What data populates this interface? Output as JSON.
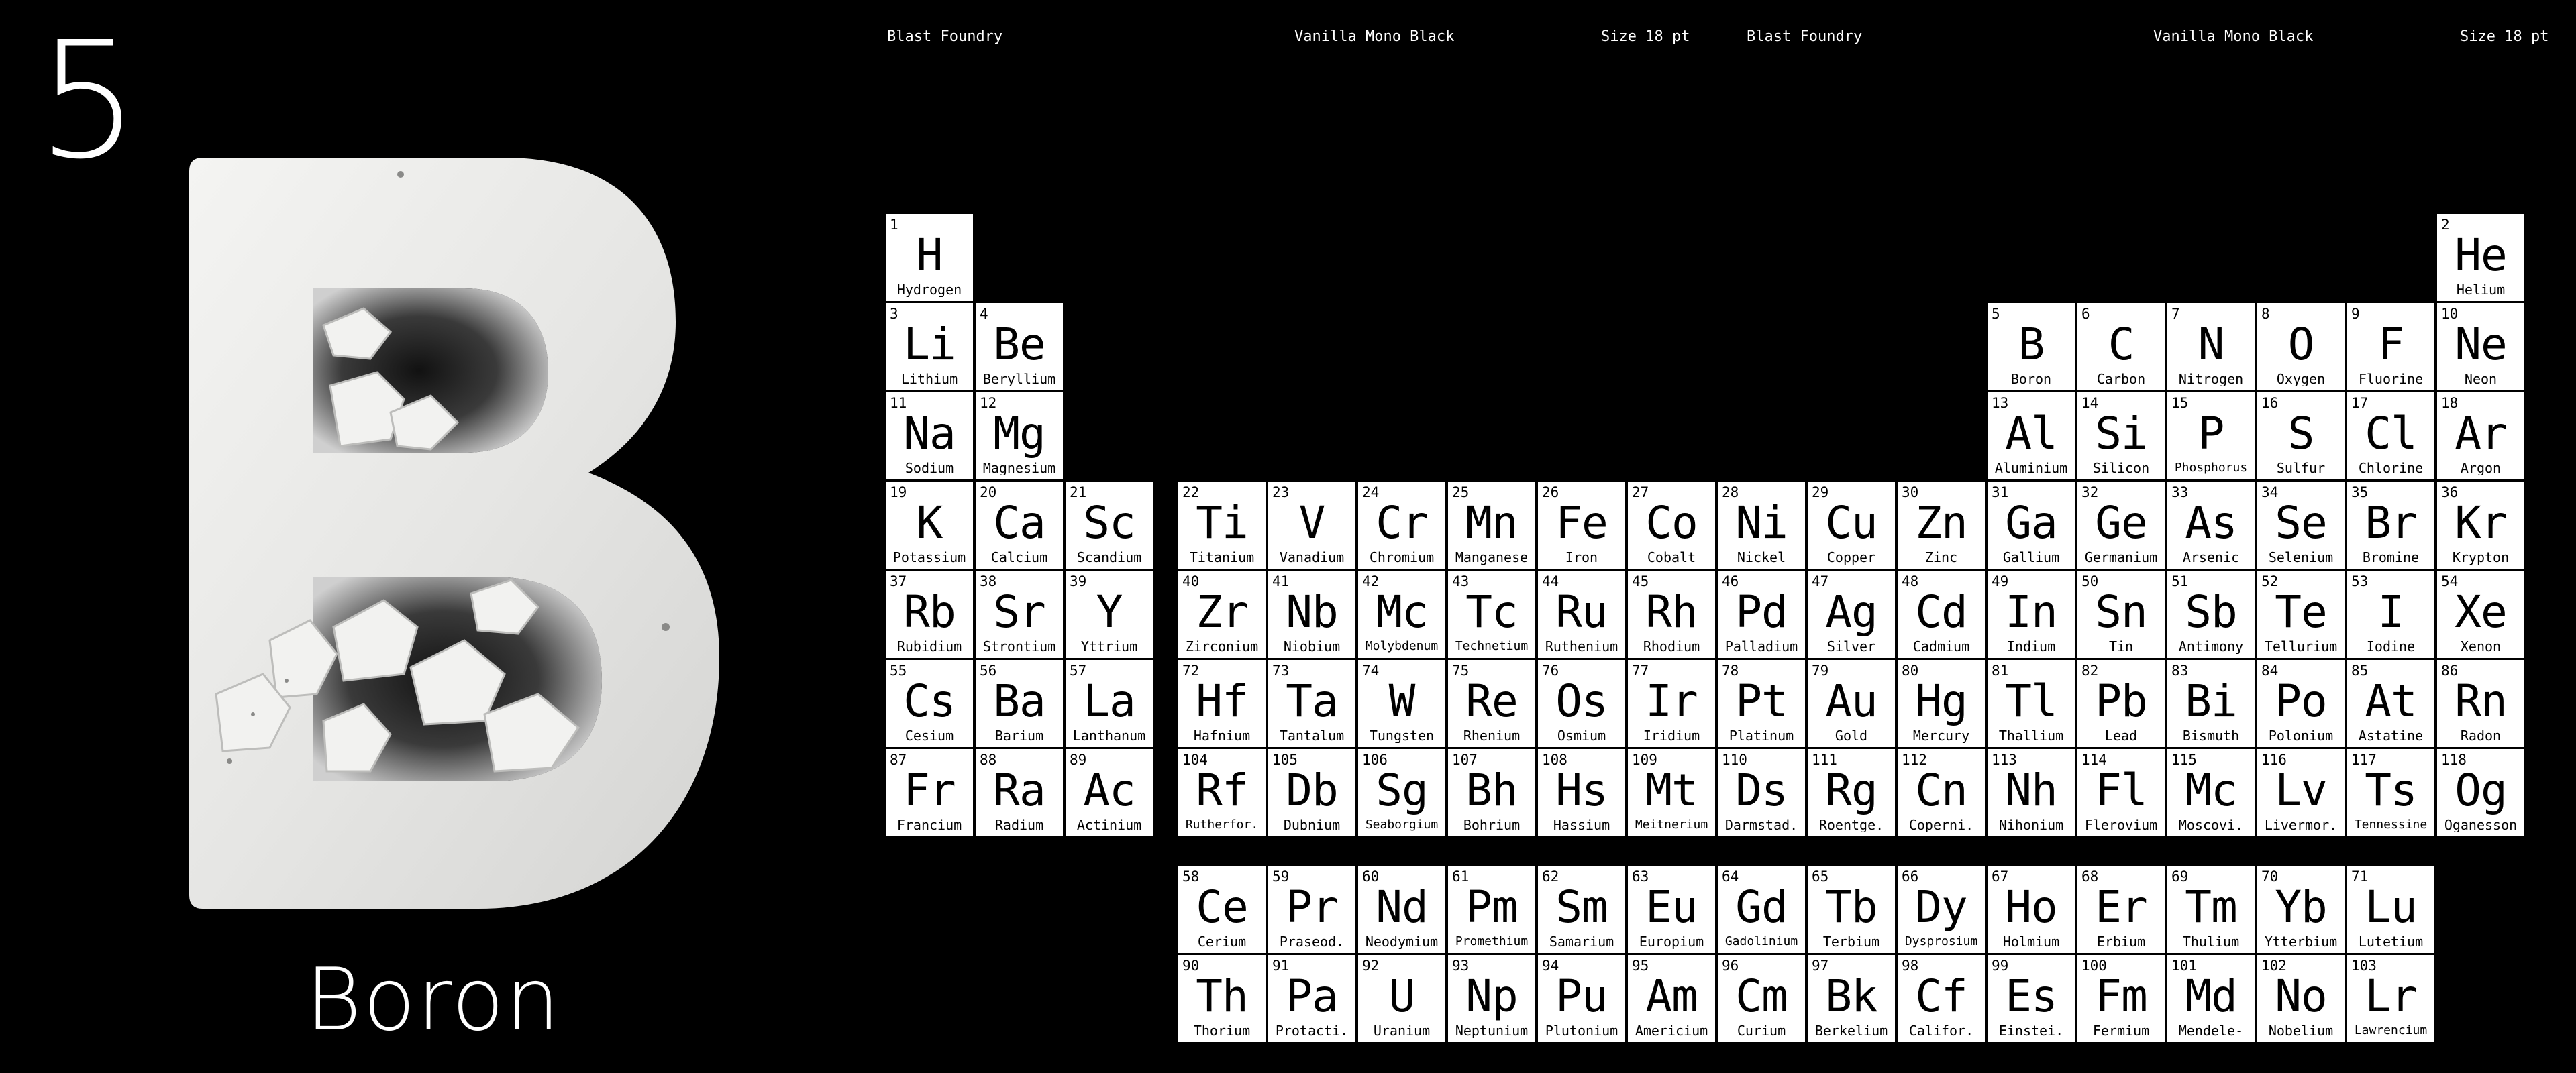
{
  "poster": {
    "atomic_number": "5",
    "letter": "B",
    "name": "Boron"
  },
  "header": {
    "left": {
      "foundry": "Blast Foundry",
      "font": "Vanilla Mono Black",
      "size": "Size 18 pt"
    },
    "right": {
      "foundry": "Blast Foundry",
      "font": "Vanilla Mono Black",
      "size": "Size 18 pt"
    }
  },
  "elements": [
    {
      "n": "1",
      "s": "H",
      "name": "Hydrogen",
      "r": 1,
      "c": 1
    },
    {
      "n": "2",
      "s": "He",
      "name": "Helium",
      "r": 1,
      "c": 18
    },
    {
      "n": "3",
      "s": "Li",
      "name": "Lithium",
      "r": 2,
      "c": 1
    },
    {
      "n": "4",
      "s": "Be",
      "name": "Beryllium",
      "r": 2,
      "c": 2
    },
    {
      "n": "5",
      "s": "B",
      "name": "Boron",
      "r": 2,
      "c": 13
    },
    {
      "n": "6",
      "s": "C",
      "name": "Carbon",
      "r": 2,
      "c": 14
    },
    {
      "n": "7",
      "s": "N",
      "name": "Nitrogen",
      "r": 2,
      "c": 15
    },
    {
      "n": "8",
      "s": "O",
      "name": "Oxygen",
      "r": 2,
      "c": 16
    },
    {
      "n": "9",
      "s": "F",
      "name": "Fluorine",
      "r": 2,
      "c": 17
    },
    {
      "n": "10",
      "s": "Ne",
      "name": "Neon",
      "r": 2,
      "c": 18
    },
    {
      "n": "11",
      "s": "Na",
      "name": "Sodium",
      "r": 3,
      "c": 1
    },
    {
      "n": "12",
      "s": "Mg",
      "name": "Magnesium",
      "r": 3,
      "c": 2
    },
    {
      "n": "13",
      "s": "Al",
      "name": "Aluminium",
      "r": 3,
      "c": 13
    },
    {
      "n": "14",
      "s": "Si",
      "name": "Silicon",
      "r": 3,
      "c": 14
    },
    {
      "n": "15",
      "s": "P",
      "name": "Phosphorus",
      "r": 3,
      "c": 15
    },
    {
      "n": "16",
      "s": "S",
      "name": "Sulfur",
      "r": 3,
      "c": 16
    },
    {
      "n": "17",
      "s": "Cl",
      "name": "Chlorine",
      "r": 3,
      "c": 17
    },
    {
      "n": "18",
      "s": "Ar",
      "name": "Argon",
      "r": 3,
      "c": 18
    },
    {
      "n": "19",
      "s": "K",
      "name": "Potassium",
      "r": 4,
      "c": 1
    },
    {
      "n": "20",
      "s": "Ca",
      "name": "Calcium",
      "r": 4,
      "c": 2
    },
    {
      "n": "21",
      "s": "Sc",
      "name": "Scandium",
      "r": 4,
      "c": 3
    },
    {
      "n": "22",
      "s": "Ti",
      "name": "Titanium",
      "r": 4,
      "c": 4
    },
    {
      "n": "23",
      "s": "V",
      "name": "Vanadium",
      "r": 4,
      "c": 5
    },
    {
      "n": "24",
      "s": "Cr",
      "name": "Chromium",
      "r": 4,
      "c": 6
    },
    {
      "n": "25",
      "s": "Mn",
      "name": "Manganese",
      "r": 4,
      "c": 7
    },
    {
      "n": "26",
      "s": "Fe",
      "name": "Iron",
      "r": 4,
      "c": 8
    },
    {
      "n": "27",
      "s": "Co",
      "name": "Cobalt",
      "r": 4,
      "c": 9
    },
    {
      "n": "28",
      "s": "Ni",
      "name": "Nickel",
      "r": 4,
      "c": 10
    },
    {
      "n": "29",
      "s": "Cu",
      "name": "Copper",
      "r": 4,
      "c": 11
    },
    {
      "n": "30",
      "s": "Zn",
      "name": "Zinc",
      "r": 4,
      "c": 12
    },
    {
      "n": "31",
      "s": "Ga",
      "name": "Gallium",
      "r": 4,
      "c": 13
    },
    {
      "n": "32",
      "s": "Ge",
      "name": "Germanium",
      "r": 4,
      "c": 14
    },
    {
      "n": "33",
      "s": "As",
      "name": "Arsenic",
      "r": 4,
      "c": 15
    },
    {
      "n": "34",
      "s": "Se",
      "name": "Selenium",
      "r": 4,
      "c": 16
    },
    {
      "n": "35",
      "s": "Br",
      "name": "Bromine",
      "r": 4,
      "c": 17
    },
    {
      "n": "36",
      "s": "Kr",
      "name": "Krypton",
      "r": 4,
      "c": 18
    },
    {
      "n": "37",
      "s": "Rb",
      "name": "Rubidium",
      "r": 5,
      "c": 1
    },
    {
      "n": "38",
      "s": "Sr",
      "name": "Strontium",
      "r": 5,
      "c": 2
    },
    {
      "n": "39",
      "s": "Y",
      "name": "Yttrium",
      "r": 5,
      "c": 3
    },
    {
      "n": "40",
      "s": "Zr",
      "name": "Zirconium",
      "r": 5,
      "c": 4
    },
    {
      "n": "41",
      "s": "Nb",
      "name": "Niobium",
      "r": 5,
      "c": 5
    },
    {
      "n": "42",
      "s": "Mc",
      "name": "Molybdenum",
      "r": 5,
      "c": 6
    },
    {
      "n": "43",
      "s": "Tc",
      "name": "Technetium",
      "r": 5,
      "c": 7
    },
    {
      "n": "44",
      "s": "Ru",
      "name": "Ruthenium",
      "r": 5,
      "c": 8
    },
    {
      "n": "45",
      "s": "Rh",
      "name": "Rhodium",
      "r": 5,
      "c": 9
    },
    {
      "n": "46",
      "s": "Pd",
      "name": "Palladium",
      "r": 5,
      "c": 10
    },
    {
      "n": "47",
      "s": "Ag",
      "name": "Silver",
      "r": 5,
      "c": 11
    },
    {
      "n": "48",
      "s": "Cd",
      "name": "Cadmium",
      "r": 5,
      "c": 12
    },
    {
      "n": "49",
      "s": "In",
      "name": "Indium",
      "r": 5,
      "c": 13
    },
    {
      "n": "50",
      "s": "Sn",
      "name": "Tin",
      "r": 5,
      "c": 14
    },
    {
      "n": "51",
      "s": "Sb",
      "name": "Antimony",
      "r": 5,
      "c": 15
    },
    {
      "n": "52",
      "s": "Te",
      "name": "Tellurium",
      "r": 5,
      "c": 16
    },
    {
      "n": "53",
      "s": "I",
      "name": "Iodine",
      "r": 5,
      "c": 17
    },
    {
      "n": "54",
      "s": "Xe",
      "name": "Xenon",
      "r": 5,
      "c": 18
    },
    {
      "n": "55",
      "s": "Cs",
      "name": "Cesium",
      "r": 6,
      "c": 1
    },
    {
      "n": "56",
      "s": "Ba",
      "name": "Barium",
      "r": 6,
      "c": 2
    },
    {
      "n": "57",
      "s": "La",
      "name": "Lanthanum",
      "r": 6,
      "c": 3
    },
    {
      "n": "72",
      "s": "Hf",
      "name": "Hafnium",
      "r": 6,
      "c": 4
    },
    {
      "n": "73",
      "s": "Ta",
      "name": "Tantalum",
      "r": 6,
      "c": 5
    },
    {
      "n": "74",
      "s": "W",
      "name": "Tungsten",
      "r": 6,
      "c": 6
    },
    {
      "n": "75",
      "s": "Re",
      "name": "Rhenium",
      "r": 6,
      "c": 7
    },
    {
      "n": "76",
      "s": "Os",
      "name": "Osmium",
      "r": 6,
      "c": 8
    },
    {
      "n": "77",
      "s": "Ir",
      "name": "Iridium",
      "r": 6,
      "c": 9
    },
    {
      "n": "78",
      "s": "Pt",
      "name": "Platinum",
      "r": 6,
      "c": 10
    },
    {
      "n": "79",
      "s": "Au",
      "name": "Gold",
      "r": 6,
      "c": 11
    },
    {
      "n": "80",
      "s": "Hg",
      "name": "Mercury",
      "r": 6,
      "c": 12
    },
    {
      "n": "81",
      "s": "Tl",
      "name": "Thallium",
      "r": 6,
      "c": 13
    },
    {
      "n": "82",
      "s": "Pb",
      "name": "Lead",
      "r": 6,
      "c": 14
    },
    {
      "n": "83",
      "s": "Bi",
      "name": "Bismuth",
      "r": 6,
      "c": 15
    },
    {
      "n": "84",
      "s": "Po",
      "name": "Polonium",
      "r": 6,
      "c": 16
    },
    {
      "n": "85",
      "s": "At",
      "name": "Astatine",
      "r": 6,
      "c": 17
    },
    {
      "n": "86",
      "s": "Rn",
      "name": "Radon",
      "r": 6,
      "c": 18
    },
    {
      "n": "87",
      "s": "Fr",
      "name": "Francium",
      "r": 7,
      "c": 1
    },
    {
      "n": "88",
      "s": "Ra",
      "name": "Radium",
      "r": 7,
      "c": 2
    },
    {
      "n": "89",
      "s": "Ac",
      "name": "Actinium",
      "r": 7,
      "c": 3
    },
    {
      "n": "104",
      "s": "Rf",
      "name": "Rutherfor.",
      "r": 7,
      "c": 4
    },
    {
      "n": "105",
      "s": "Db",
      "name": "Dubnium",
      "r": 7,
      "c": 5
    },
    {
      "n": "106",
      "s": "Sg",
      "name": "Seaborgium",
      "r": 7,
      "c": 6
    },
    {
      "n": "107",
      "s": "Bh",
      "name": "Bohrium",
      "r": 7,
      "c": 7
    },
    {
      "n": "108",
      "s": "Hs",
      "name": "Hassium",
      "r": 7,
      "c": 8
    },
    {
      "n": "109",
      "s": "Mt",
      "name": "Meitnerium",
      "r": 7,
      "c": 9
    },
    {
      "n": "110",
      "s": "Ds",
      "name": "Darmstad.",
      "r": 7,
      "c": 10
    },
    {
      "n": "111",
      "s": "Rg",
      "name": "Roentge.",
      "r": 7,
      "c": 11
    },
    {
      "n": "112",
      "s": "Cn",
      "name": "Coperni.",
      "r": 7,
      "c": 12
    },
    {
      "n": "113",
      "s": "Nh",
      "name": "Nihonium",
      "r": 7,
      "c": 13
    },
    {
      "n": "114",
      "s": "Fl",
      "name": "Flerovium",
      "r": 7,
      "c": 14
    },
    {
      "n": "115",
      "s": "Mc",
      "name": "Moscovi.",
      "r": 7,
      "c": 15
    },
    {
      "n": "116",
      "s": "Lv",
      "name": "Livermor.",
      "r": 7,
      "c": 16
    },
    {
      "n": "117",
      "s": "Ts",
      "name": "Tennessine",
      "r": 7,
      "c": 17
    },
    {
      "n": "118",
      "s": "Og",
      "name": "Oganesson",
      "r": 7,
      "c": 18
    },
    {
      "n": "58",
      "s": "Ce",
      "name": "Cerium",
      "r": 8,
      "c": 4
    },
    {
      "n": "59",
      "s": "Pr",
      "name": "Praseod.",
      "r": 8,
      "c": 5
    },
    {
      "n": "60",
      "s": "Nd",
      "name": "Neodymium",
      "r": 8,
      "c": 6
    },
    {
      "n": "61",
      "s": "Pm",
      "name": "Promethium",
      "r": 8,
      "c": 7
    },
    {
      "n": "62",
      "s": "Sm",
      "name": "Samarium",
      "r": 8,
      "c": 8
    },
    {
      "n": "63",
      "s": "Eu",
      "name": "Europium",
      "r": 8,
      "c": 9
    },
    {
      "n": "64",
      "s": "Gd",
      "name": "Gadolinium",
      "r": 8,
      "c": 10
    },
    {
      "n": "65",
      "s": "Tb",
      "name": "Terbium",
      "r": 8,
      "c": 11
    },
    {
      "n": "66",
      "s": "Dy",
      "name": "Dysprosium",
      "r": 8,
      "c": 12
    },
    {
      "n": "67",
      "s": "Ho",
      "name": "Holmium",
      "r": 8,
      "c": 13
    },
    {
      "n": "68",
      "s": "Er",
      "name": "Erbium",
      "r": 8,
      "c": 14
    },
    {
      "n": "69",
      "s": "Tm",
      "name": "Thulium",
      "r": 8,
      "c": 15
    },
    {
      "n": "70",
      "s": "Yb",
      "name": "Ytterbium",
      "r": 8,
      "c": 16
    },
    {
      "n": "71",
      "s": "Lu",
      "name": "Lutetium",
      "r": 8,
      "c": 17
    },
    {
      "n": "90",
      "s": "Th",
      "name": "Thorium",
      "r": 9,
      "c": 4
    },
    {
      "n": "91",
      "s": "Pa",
      "name": "Protacti.",
      "r": 9,
      "c": 5
    },
    {
      "n": "92",
      "s": "U",
      "name": "Uranium",
      "r": 9,
      "c": 6
    },
    {
      "n": "93",
      "s": "Np",
      "name": "Neptunium",
      "r": 9,
      "c": 7
    },
    {
      "n": "94",
      "s": "Pu",
      "name": "Plutonium",
      "r": 9,
      "c": 8
    },
    {
      "n": "95",
      "s": "Am",
      "name": "Americium",
      "r": 9,
      "c": 9
    },
    {
      "n": "96",
      "s": "Cm",
      "name": "Curium",
      "r": 9,
      "c": 10
    },
    {
      "n": "97",
      "s": "Bk",
      "name": "Berkelium",
      "r": 9,
      "c": 11
    },
    {
      "n": "98",
      "s": "Cf",
      "name": "Califor.",
      "r": 9,
      "c": 12
    },
    {
      "n": "99",
      "s": "Es",
      "name": "Einstei.",
      "r": 9,
      "c": 13
    },
    {
      "n": "100",
      "s": "Fm",
      "name": "Fermium",
      "r": 9,
      "c": 14
    },
    {
      "n": "101",
      "s": "Md",
      "name": "Mendele-",
      "r": 9,
      "c": 15
    },
    {
      "n": "102",
      "s": "No",
      "name": "Nobelium",
      "r": 9,
      "c": 16
    },
    {
      "n": "103",
      "s": "Lr",
      "name": "Lawrencium",
      "r": 9,
      "c": 17
    }
  ]
}
